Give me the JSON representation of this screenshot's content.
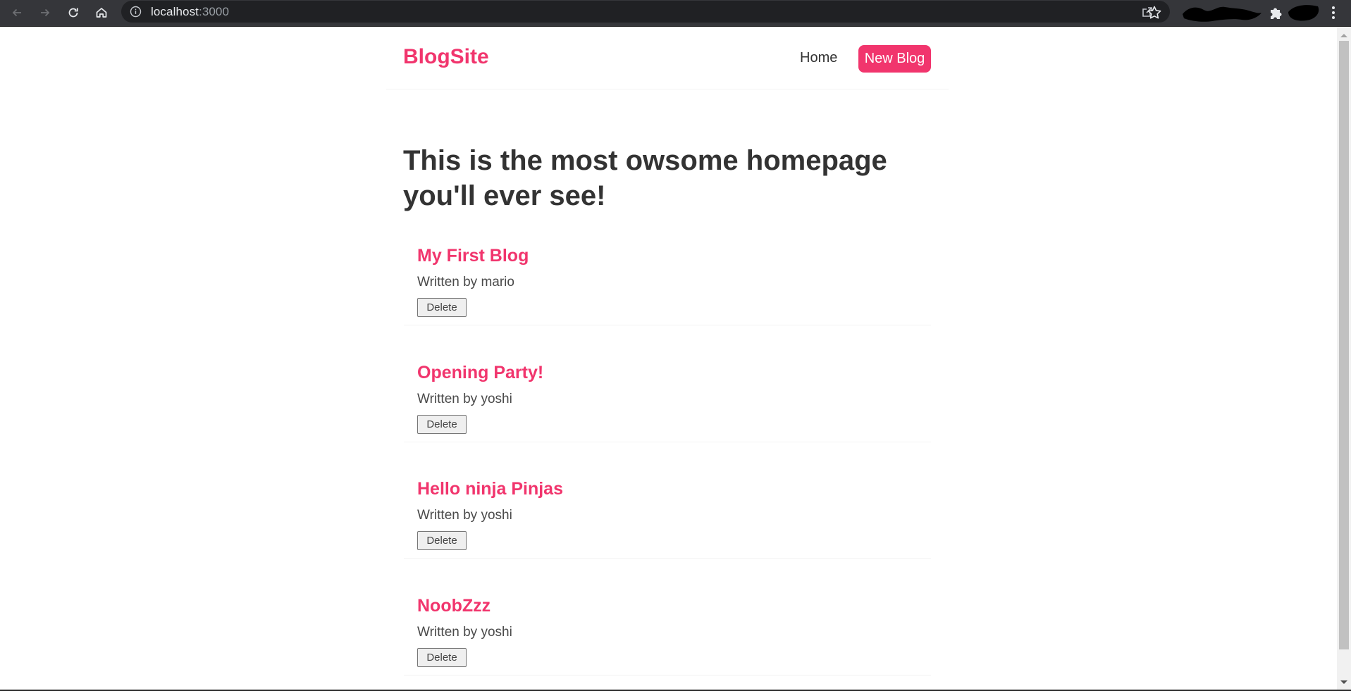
{
  "browser": {
    "url_host": "localhost",
    "url_port": ":3000"
  },
  "site": {
    "brand": "BlogSite",
    "nav": {
      "home_label": "Home",
      "new_blog_label": "New Blog"
    },
    "heading": "This is the most owsome homepage you'll ever see!",
    "accent_color": "#f1356d",
    "blogs": [
      {
        "title": "My First Blog",
        "author": "Written by mario",
        "delete_label": "Delete"
      },
      {
        "title": "Opening Party!",
        "author": "Written by yoshi",
        "delete_label": "Delete"
      },
      {
        "title": "Hello ninja Pinjas",
        "author": "Written by yoshi",
        "delete_label": "Delete"
      },
      {
        "title": "NoobZzz",
        "author": "Written by yoshi",
        "delete_label": "Delete"
      }
    ]
  },
  "icons": {
    "back": "back-arrow-icon",
    "forward": "forward-arrow-icon",
    "reload": "reload-icon",
    "home": "home-icon",
    "info": "info-icon",
    "share": "share-icon",
    "bookmark": "star-icon",
    "extensions": "puzzle-icon",
    "menu": "kebab-menu-icon"
  }
}
